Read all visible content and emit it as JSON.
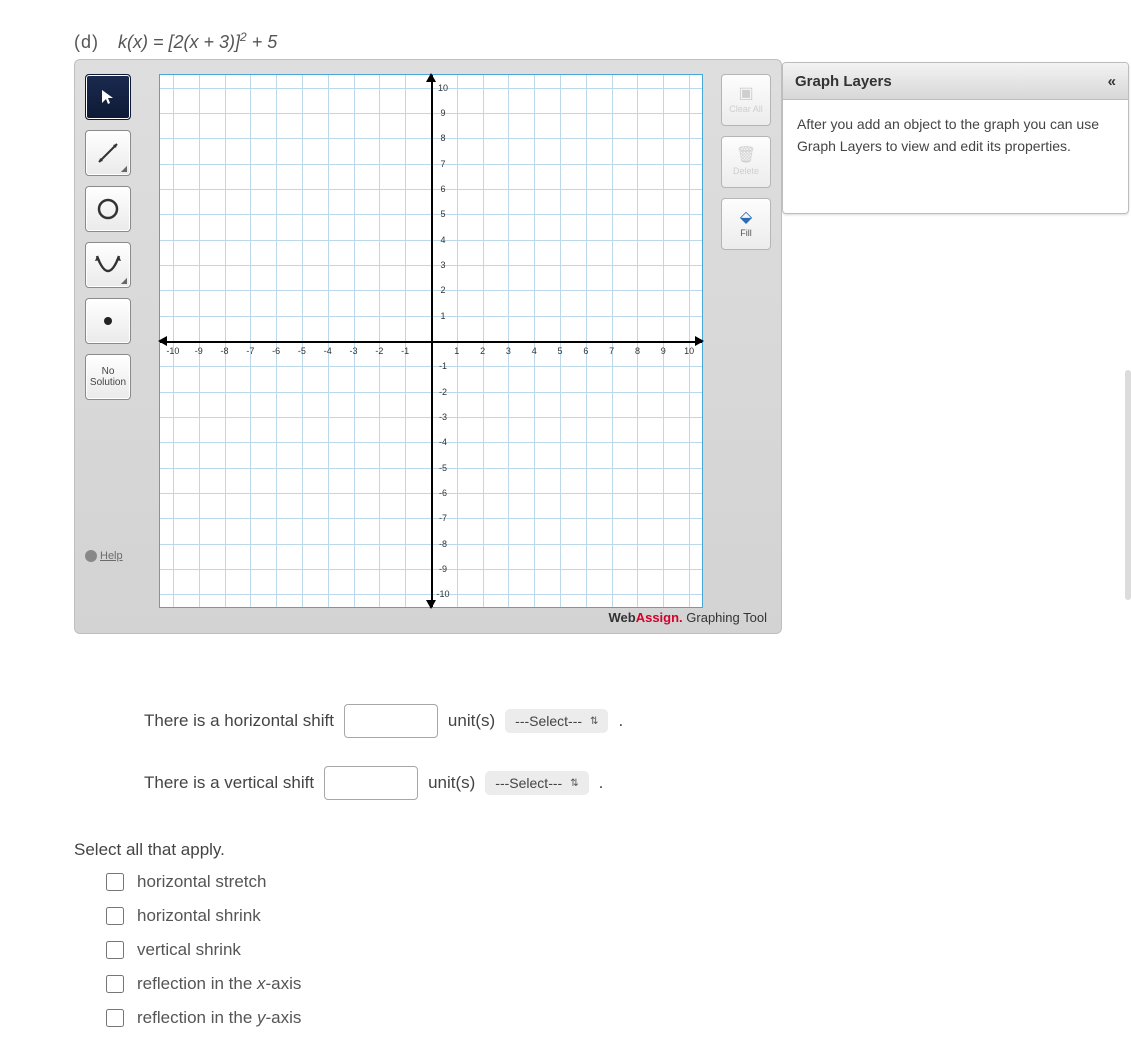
{
  "question": {
    "part": "(d)",
    "func_html": "k(x) = [2(x + 3)]<sup>2</sup> + 5"
  },
  "grapher": {
    "tools": {
      "pointer": "pointer",
      "line": "line",
      "circle": "circle",
      "parabola": "parabola",
      "point": "point",
      "no_solution_label": "No\nSolution",
      "help": "Help"
    },
    "actions": {
      "clear_all": "Clear All",
      "delete": "Delete",
      "fill": "Fill"
    },
    "axes": {
      "x_ticks": [
        "-10",
        "-9",
        "-8",
        "-7",
        "-6",
        "-5",
        "-4",
        "-3",
        "-2",
        "-1",
        "1",
        "2",
        "3",
        "4",
        "5",
        "6",
        "7",
        "8",
        "9",
        "10"
      ],
      "y_ticks": [
        "10",
        "9",
        "8",
        "7",
        "6",
        "5",
        "4",
        "3",
        "2",
        "1",
        "-1",
        "-2",
        "-3",
        "-4",
        "-5",
        "-6",
        "-7",
        "-8",
        "-9",
        "-10"
      ]
    },
    "brand": {
      "web": "Web",
      "assign": "Assign.",
      "rest": " Graphing Tool"
    }
  },
  "layers": {
    "title": "Graph Layers",
    "hint": "After you add an object to the graph you can use Graph Layers to view and edit its properties."
  },
  "answers": {
    "hshift_prefix": "There is a horizontal shift",
    "vshift_prefix": "There is a vertical shift",
    "units": "unit(s)",
    "select_placeholder": "---Select---",
    "period": "."
  },
  "apply": {
    "title": "Select all that apply.",
    "options": [
      "horizontal stretch",
      "horizontal shrink",
      "vertical shrink",
      "reflection in the x-axis",
      "reflection in the y-axis"
    ]
  },
  "chart_data": {
    "type": "scatter",
    "title": "",
    "xlabel": "",
    "ylabel": "",
    "xlim": [
      -10.5,
      10.5
    ],
    "ylim": [
      -10.5,
      10.5
    ],
    "x_ticks": [
      -10,
      -9,
      -8,
      -7,
      -6,
      -5,
      -4,
      -3,
      -2,
      -1,
      0,
      1,
      2,
      3,
      4,
      5,
      6,
      7,
      8,
      9,
      10
    ],
    "y_ticks": [
      -10,
      -9,
      -8,
      -7,
      -6,
      -5,
      -4,
      -3,
      -2,
      -1,
      0,
      1,
      2,
      3,
      4,
      5,
      6,
      7,
      8,
      9,
      10
    ],
    "series": []
  }
}
